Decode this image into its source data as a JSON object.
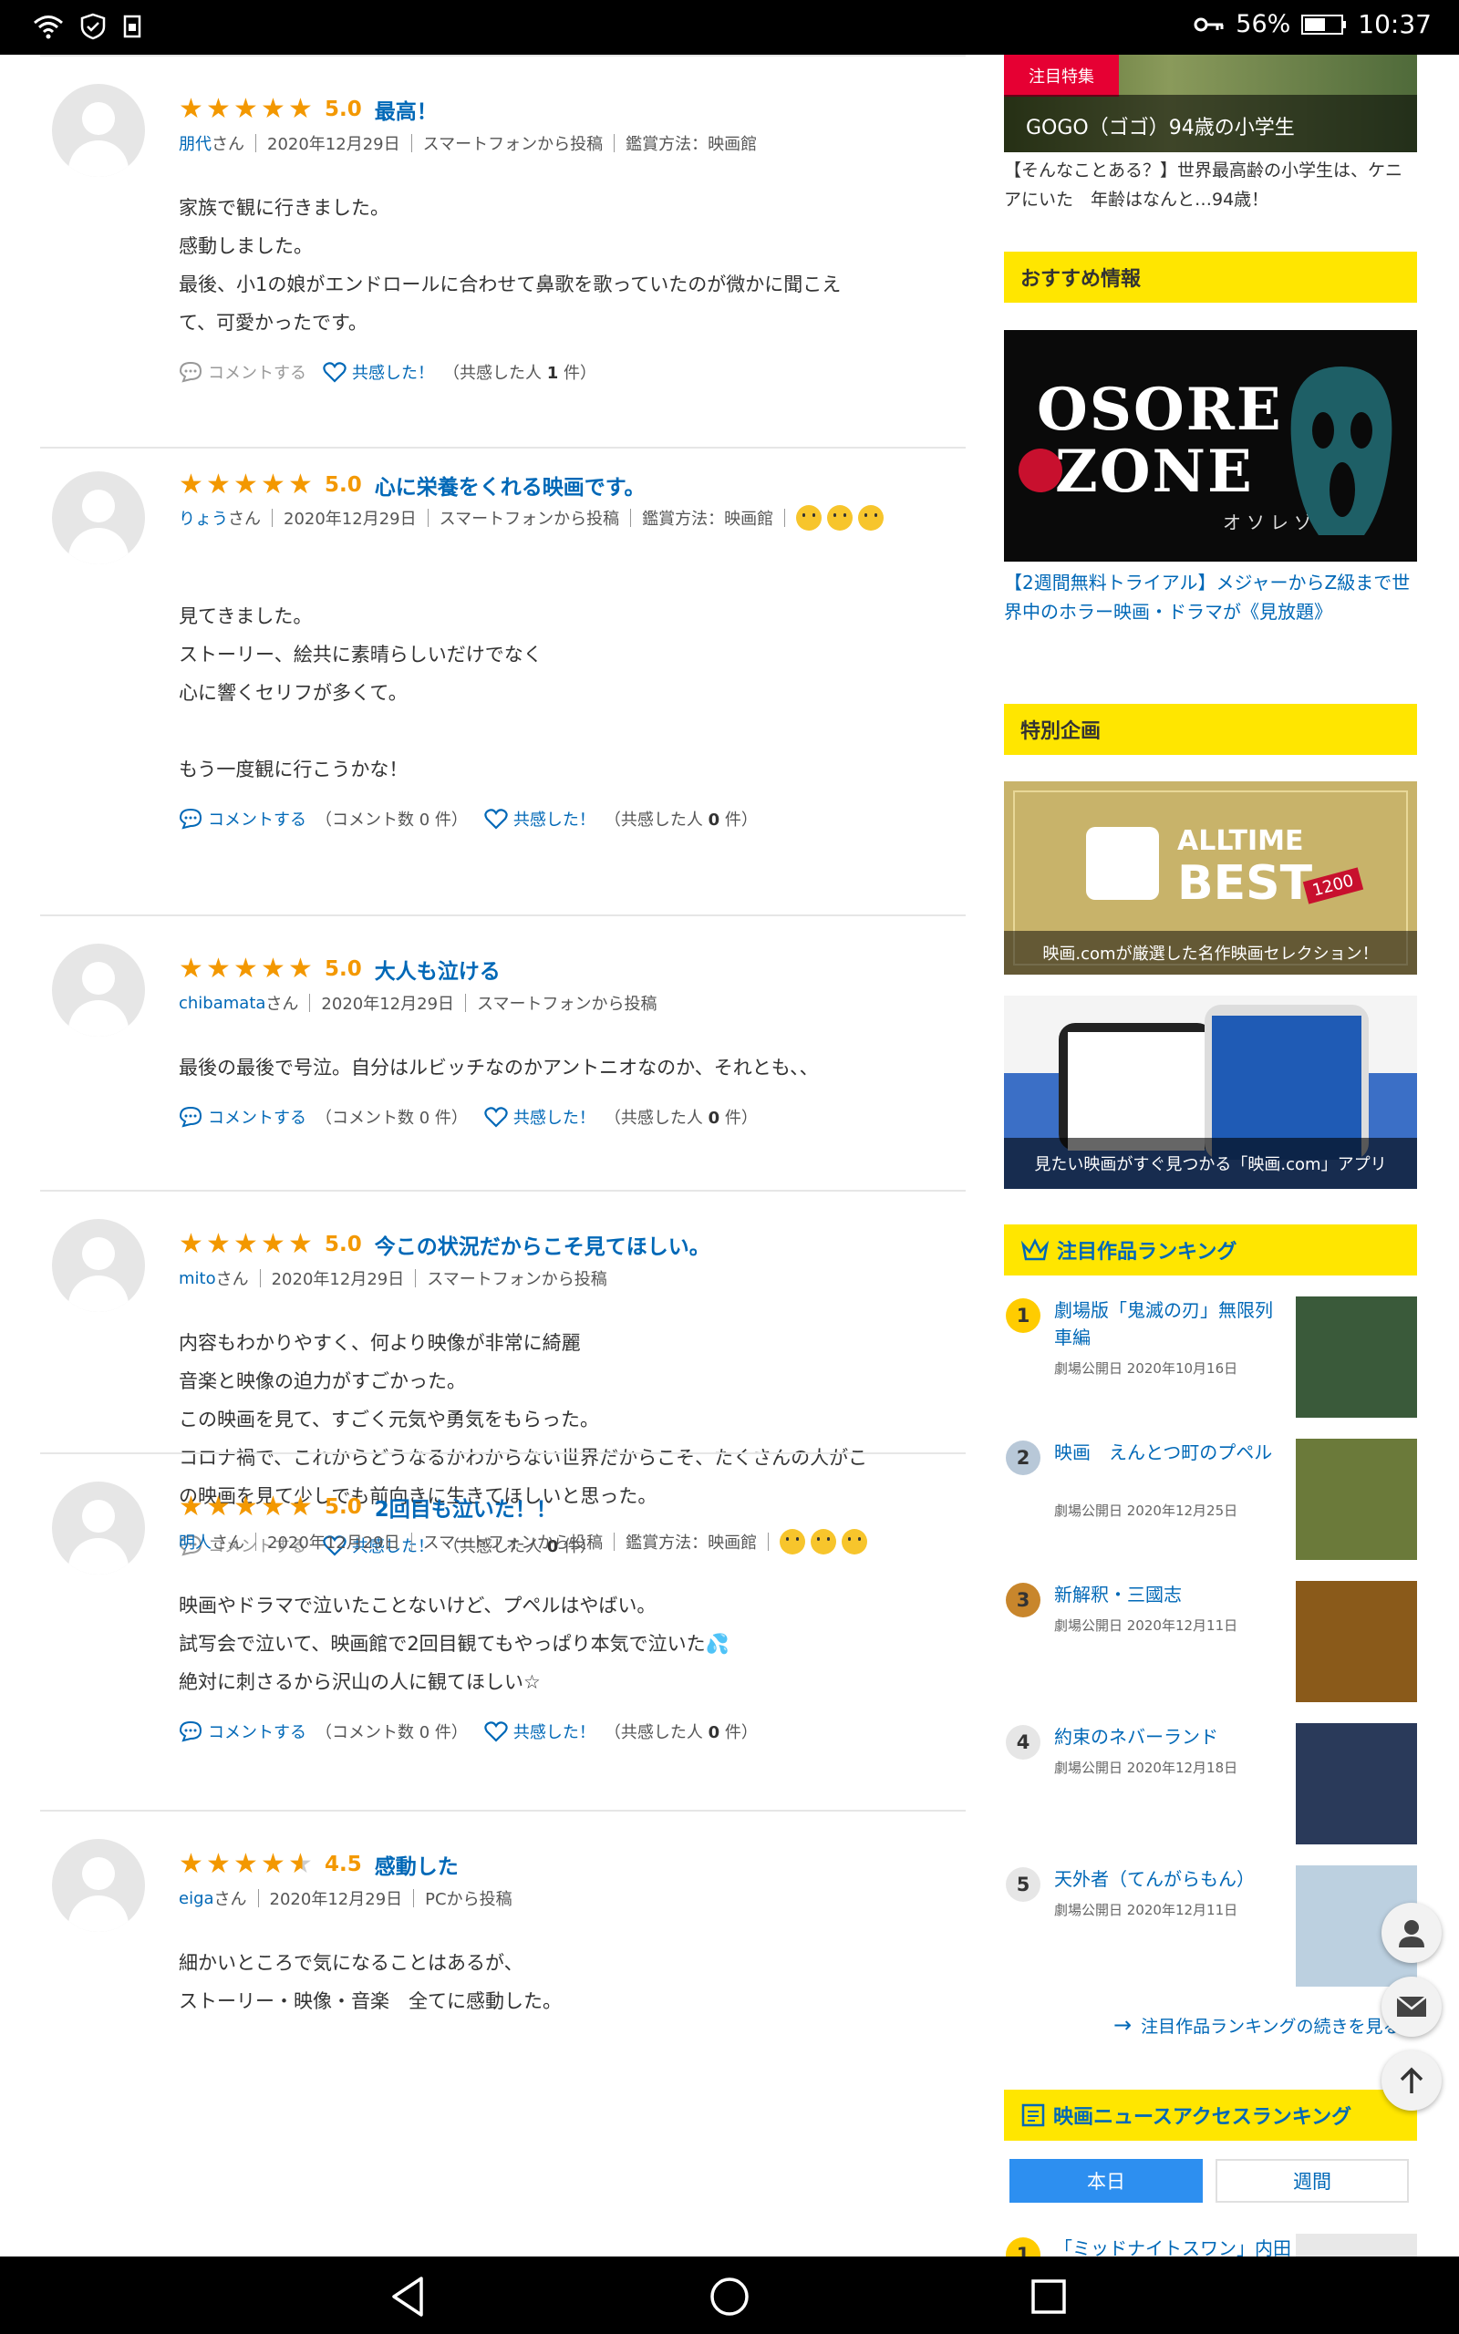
{
  "status_bar": {
    "battery": "56%",
    "time": "10:37"
  },
  "reviews": [
    {
      "user": "朋代",
      "san": "さん",
      "date": "2020年12月29日",
      "via": "スマートフォンから投稿",
      "method": "鑑賞方法：映画館",
      "score": "5.0",
      "rating": 5,
      "title": "最高！",
      "lines": [
        "家族で観に行きました。",
        "感動しました。",
        "最後、小1の娘がエンドロールに合わせて鼻歌を歌っていたのが微かに聞こえ",
        "て、可愛かったです。"
      ],
      "comment_label": "コメントする",
      "comment_count": "",
      "like_label": "共感した！",
      "like_prefix": "（共感した人",
      "like_count": "1",
      "like_suffix": "件）"
    },
    {
      "user": "りょう",
      "san": "さん",
      "date": "2020年12月29日",
      "via": "スマートフォンから投稿",
      "method": "鑑賞方法：映画館",
      "score": "5.0",
      "rating": 5,
      "title": "心に栄養をくれる映画です。",
      "lines": [
        "見てきました。",
        "ストーリー、絵共に素晴らしいだけでなく",
        "心に響くセリフが多くて。",
        "",
        "もう一度観に行こうかな！"
      ],
      "comment_label": "コメントする",
      "comment_count": "（コメント数 0 件）",
      "like_label": "共感した！",
      "like_prefix": "（共感した人",
      "like_count": "0",
      "like_suffix": "件）"
    },
    {
      "user": "chibamata",
      "san": "さん",
      "date": "2020年12月29日",
      "via": "スマートフォンから投稿",
      "method": "",
      "score": "5.0",
      "rating": 5,
      "title": "大人も泣ける",
      "lines": [
        "最後の最後で号泣。自分はルビッチなのかアントニオなのか、それとも、、"
      ],
      "comment_label": "コメントする",
      "comment_count": "（コメント数 0 件）",
      "like_label": "共感した！",
      "like_prefix": "（共感した人",
      "like_count": "0",
      "like_suffix": "件）"
    },
    {
      "user": "mito",
      "san": "さん",
      "date": "2020年12月29日",
      "via": "スマートフォンから投稿",
      "method": "",
      "score": "5.0",
      "rating": 5,
      "title": "今この状況だからこそ見てほしい。",
      "lines": [
        "内容もわかりやすく、何より映像が非常に綺麗",
        "音楽と映像の迫力がすごかった。",
        "この映画を見て、すごく元気や勇気をもらった。",
        "コロナ禍で、これからどうなるかわからない世界だからこそ、たくさんの人がこ",
        "の映画を見て少しでも前向きに生きてほしいと思った。"
      ],
      "comment_label": "コメントする",
      "comment_count": "",
      "like_label": "共感した！",
      "like_prefix": "（共感した人",
      "like_count": "0",
      "like_suffix": "件）"
    },
    {
      "user": "明人",
      "san": "さん",
      "date": "2020年12月29日",
      "via": "スマートフォンから投稿",
      "method": "鑑賞方法：映画館",
      "score": "5.0",
      "rating": 5,
      "title": "2回目も泣いた！！",
      "lines": [
        "映画やドラマで泣いたことないけど、プペルはやばい。",
        "試写会で泣いて、映画館で2回目観てもやっぱり本気で泣いた💦",
        "絶対に刺さるから沢山の人に観てほしい☆"
      ],
      "comment_label": "コメントする",
      "comment_count": "（コメント数 0 件）",
      "like_label": "共感した！",
      "like_prefix": "（共感した人",
      "like_count": "0",
      "like_suffix": "件）"
    },
    {
      "user": "eiga",
      "san": "さん",
      "date": "2020年12月29日",
      "via": "PCから投稿",
      "method": "",
      "score": "4.5",
      "rating": 4.5,
      "title": "感動した",
      "lines": [
        "細かいところで気になることはあるが、",
        "ストーリー・映像・音楽　全てに感動した。"
      ]
    }
  ],
  "side": {
    "feature_badge": "注目特集",
    "feature_caption": "GOGO（ゴゴ）94歳の小学生",
    "feature_link": "【そんなことある？】世界最高齢の小学生は、ケニアにいた　年齢はなんと…94歳！",
    "recommend_head": "おすすめ情報",
    "osore_top": "OSORE",
    "osore_bottom": "ZONE",
    "osore_kana": "オソレゾーン",
    "recommend_link": "【2週間無料トライアル】メジャーからZ級まで世界中のホラー映画・ドラマが《見放題》",
    "special_head": "特別企画",
    "alltime_word": "ALLTIME",
    "best_word": "BEST",
    "best_num": "1200",
    "alltime_caption": "映画.comが厳選した名作映画セレクション！",
    "app_caption": "見たい映画がすぐ見つかる「映画.com」アプリ",
    "ranking_head": "注目作品ランキング",
    "ranking": [
      {
        "n": "1",
        "title": "劇場版「鬼滅の刃」無限列車編",
        "date": "劇場公開日 2020年10月16日",
        "color": "#ffcc00"
      },
      {
        "n": "2",
        "title": "映画　えんとつ町のプペル",
        "date": "劇場公開日 2020年12月25日",
        "color": "#b8c8d8"
      },
      {
        "n": "3",
        "title": "新解釈・三國志",
        "date": "劇場公開日 2020年12月11日",
        "color": "#c8862c"
      },
      {
        "n": "4",
        "title": "約束のネバーランド",
        "date": "劇場公開日 2020年12月18日",
        "color": "#e6e6e6"
      },
      {
        "n": "5",
        "title": "天外者（てんがらもん）",
        "date": "劇場公開日 2020年12月11日",
        "color": "#e6e6e6"
      }
    ],
    "ranking_more": "注目作品ランキングの続きを見る",
    "news_head": "映画ニュースアクセスランキング",
    "tab_today": "本日",
    "tab_week": "週間",
    "news_first": "「ミッドナイトスワン」内田"
  }
}
